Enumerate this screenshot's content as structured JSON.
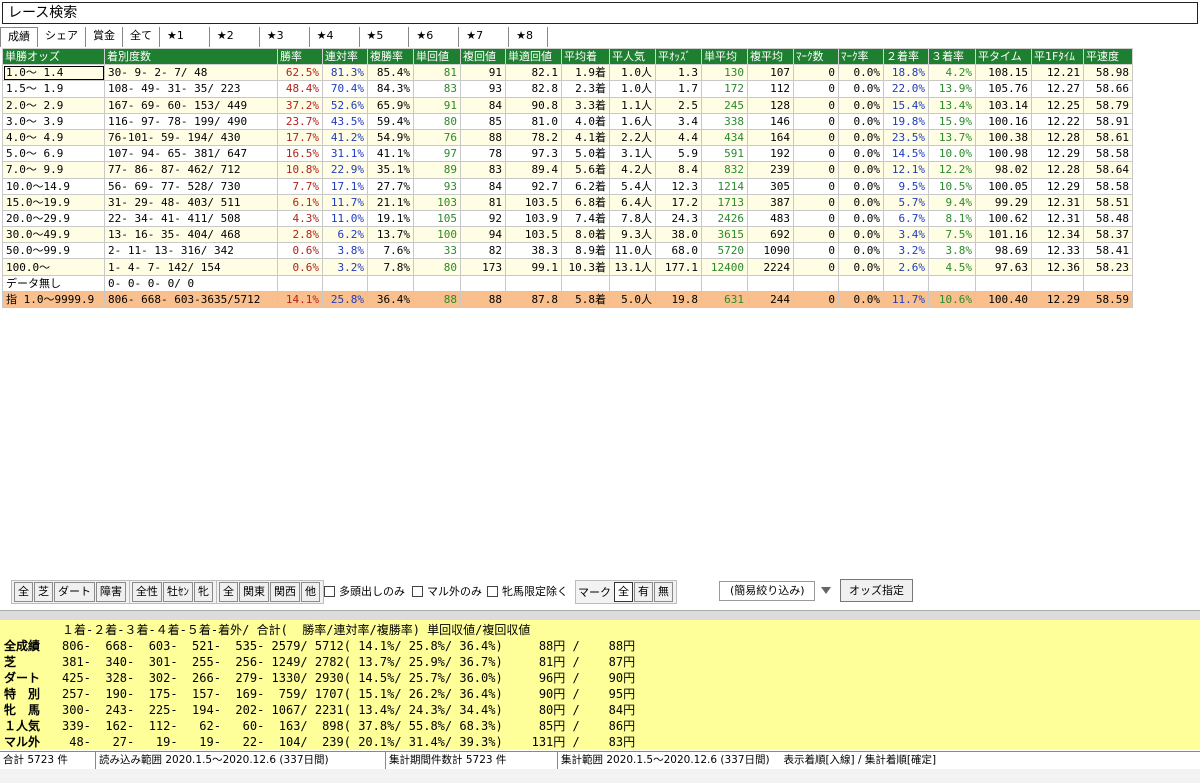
{
  "title": "レース検索",
  "tabs": [
    "成績",
    "シェア",
    "賞金",
    "全て",
    "★1",
    "★2",
    "★3",
    "★4",
    "★5",
    "★6",
    "★7",
    "★8"
  ],
  "headers": [
    "単勝オッズ",
    "着別度数",
    "勝率",
    "連対率",
    "複勝率",
    "単回値",
    "複回値",
    "単適回値",
    "平均着",
    "平人気",
    "平ｵｯｽﾞ",
    "単平均",
    "複平均",
    "ﾏｰｸ数",
    "ﾏｰｸ率",
    "２着率",
    "３着率",
    "平タイム",
    "平1Fﾀｲﾑ",
    "平速度"
  ],
  "rows": [
    [
      "1.0～ 1.4",
      "30-  9-  2-   7/  48",
      "62.5%",
      "81.3%",
      "85.4%",
      "81",
      "91",
      "82.1",
      "1.9着",
      "1.0人",
      "1.3",
      "130",
      "107",
      "0",
      "0.0%",
      "18.8%",
      "4.2%",
      "108.15",
      "12.21",
      "58.98"
    ],
    [
      "1.5～ 1.9",
      "108- 49- 31-  35/ 223",
      "48.4%",
      "70.4%",
      "84.3%",
      "83",
      "93",
      "82.8",
      "2.3着",
      "1.0人",
      "1.7",
      "172",
      "112",
      "0",
      "0.0%",
      "22.0%",
      "13.9%",
      "105.76",
      "12.27",
      "58.66"
    ],
    [
      "2.0～ 2.9",
      "167- 69- 60- 153/ 449",
      "37.2%",
      "52.6%",
      "65.9%",
      "91",
      "84",
      "90.8",
      "3.3着",
      "1.1人",
      "2.5",
      "245",
      "128",
      "0",
      "0.0%",
      "15.4%",
      "13.4%",
      "103.14",
      "12.25",
      "58.79"
    ],
    [
      "3.0～ 3.9",
      "116- 97- 78- 199/ 490",
      "23.7%",
      "43.5%",
      "59.4%",
      "80",
      "85",
      "81.0",
      "4.0着",
      "1.6人",
      "3.4",
      "338",
      "146",
      "0",
      "0.0%",
      "19.8%",
      "15.9%",
      "100.16",
      "12.22",
      "58.91"
    ],
    [
      "4.0～ 4.9",
      "76-101- 59- 194/ 430",
      "17.7%",
      "41.2%",
      "54.9%",
      "76",
      "88",
      "78.2",
      "4.1着",
      "2.2人",
      "4.4",
      "434",
      "164",
      "0",
      "0.0%",
      "23.5%",
      "13.7%",
      "100.38",
      "12.28",
      "58.61"
    ],
    [
      "5.0～ 6.9",
      "107- 94- 65- 381/ 647",
      "16.5%",
      "31.1%",
      "41.1%",
      "97",
      "78",
      "97.3",
      "5.0着",
      "3.1人",
      "5.9",
      "591",
      "192",
      "0",
      "0.0%",
      "14.5%",
      "10.0%",
      "100.98",
      "12.29",
      "58.58"
    ],
    [
      "7.0～ 9.9",
      "77- 86- 87- 462/ 712",
      "10.8%",
      "22.9%",
      "35.1%",
      "89",
      "83",
      "89.4",
      "5.6着",
      "4.2人",
      "8.4",
      "832",
      "239",
      "0",
      "0.0%",
      "12.1%",
      "12.2%",
      "98.02",
      "12.28",
      "58.64"
    ],
    [
      "10.0～14.9",
      "56- 69- 77- 528/ 730",
      "7.7%",
      "17.1%",
      "27.7%",
      "93",
      "84",
      "92.7",
      "6.2着",
      "5.4人",
      "12.3",
      "1214",
      "305",
      "0",
      "0.0%",
      "9.5%",
      "10.5%",
      "100.05",
      "12.29",
      "58.58"
    ],
    [
      "15.0～19.9",
      "31- 29- 48- 403/ 511",
      "6.1%",
      "11.7%",
      "21.1%",
      "103",
      "81",
      "103.5",
      "6.8着",
      "6.4人",
      "17.2",
      "1713",
      "387",
      "0",
      "0.0%",
      "5.7%",
      "9.4%",
      "99.29",
      "12.31",
      "58.51"
    ],
    [
      "20.0～29.9",
      "22- 34- 41- 411/ 508",
      "4.3%",
      "11.0%",
      "19.1%",
      "105",
      "92",
      "103.9",
      "7.4着",
      "7.8人",
      "24.3",
      "2426",
      "483",
      "0",
      "0.0%",
      "6.7%",
      "8.1%",
      "100.62",
      "12.31",
      "58.48"
    ],
    [
      "30.0～49.9",
      "13- 16- 35- 404/ 468",
      "2.8%",
      "6.2%",
      "13.7%",
      "100",
      "94",
      "103.5",
      "8.0着",
      "9.3人",
      "38.0",
      "3615",
      "692",
      "0",
      "0.0%",
      "3.4%",
      "7.5%",
      "101.16",
      "12.34",
      "58.37"
    ],
    [
      "50.0～99.9",
      "2- 11- 13- 316/ 342",
      "0.6%",
      "3.8%",
      "7.6%",
      "33",
      "82",
      "38.3",
      "8.9着",
      "11.0人",
      "68.0",
      "5720",
      "1090",
      "0",
      "0.0%",
      "3.2%",
      "3.8%",
      "98.69",
      "12.33",
      "58.41"
    ],
    [
      "100.0～",
      "1-  4-  7- 142/ 154",
      "0.6%",
      "3.2%",
      "7.8%",
      "80",
      "173",
      "99.1",
      "10.3着",
      "13.1人",
      "177.1",
      "12400",
      "2224",
      "0",
      "0.0%",
      "2.6%",
      "4.5%",
      "97.63",
      "12.36",
      "58.23"
    ],
    [
      "データ無し",
      "0-  0-  0-   0/   0",
      "",
      "",
      "",
      "",
      "",
      "",
      "",
      "",
      "",
      "",
      "",
      "",
      "",
      "",
      "",
      "",
      "",
      ""
    ],
    [
      "指 1.0～9999.9",
      "806- 668- 603-3635/5712",
      "14.1%",
      "25.8%",
      "36.4%",
      "88",
      "88",
      "87.8",
      "5.8着",
      "5.0人",
      "19.8",
      "631",
      "244",
      "0",
      "0.0%",
      "11.7%",
      "10.6%",
      "100.40",
      "12.29",
      "58.59"
    ]
  ],
  "filters": {
    "course": [
      "全",
      "芝",
      "ダート",
      "障害"
    ],
    "sex": [
      "全性",
      "牡ｾﾝ",
      "牝"
    ],
    "region": [
      "全",
      "関東",
      "関西",
      "他"
    ],
    "checks": [
      "多頭出しのみ",
      "マル外のみ",
      "牝馬限定除く"
    ],
    "mark_label": "マーク",
    "mark": [
      "全",
      "有",
      "無"
    ],
    "dropdown": "(簡易絞り込み)",
    "odds_button": "オッズ指定"
  },
  "summary": {
    "header": "１着-２着-３着-４着-５着-着外/ 合計(  勝率/連対率/複勝率) 単回収値/複回収値",
    "labels": [
      "全成績",
      "芝",
      "ダート",
      "特　別",
      "牝　馬",
      "１人気",
      "マル外"
    ],
    "lines": [
      "806-  668-  603-  521-  535- 2579/ 5712( 14.1%/ 25.8%/ 36.4%)     88円 /    88円",
      "381-  340-  301-  255-  256- 1249/ 2782( 13.7%/ 25.9%/ 36.7%)     81円 /    87円",
      "425-  328-  302-  266-  279- 1330/ 2930( 14.5%/ 25.7%/ 36.0%)     96円 /    90円",
      "257-  190-  175-  157-  169-  759/ 1707( 15.1%/ 26.2%/ 36.4%)     90円 /    95円",
      "300-  243-  225-  194-  202- 1067/ 2231( 13.4%/ 24.3%/ 34.4%)     80円 /    84円",
      "339-  162-  112-   62-   60-  163/  898( 37.8%/ 55.8%/ 68.3%)     85円 /    86円",
      " 48-   27-   19-   19-   22-  104/  239( 20.1%/ 31.4%/ 39.3%)    131円 /    83円"
    ]
  },
  "status": [
    "合計 5723 件",
    "読み込み範囲 2020.1.5～2020.12.6 (337日間)",
    "集計期間件数計 5723 件",
    "集計範囲 2020.1.5～2020.12.6 (337日間)　 表示着順[入線] / 集計着順[確定]"
  ],
  "colors": {
    "header_green": "#1f7f31",
    "row_yellow": "#fffde3",
    "total_orange": "#f9c08e",
    "summary_yellow": "#ffff99",
    "red": "#b0221c",
    "blue": "#1f3bbd",
    "green": "#2a8a2a"
  }
}
